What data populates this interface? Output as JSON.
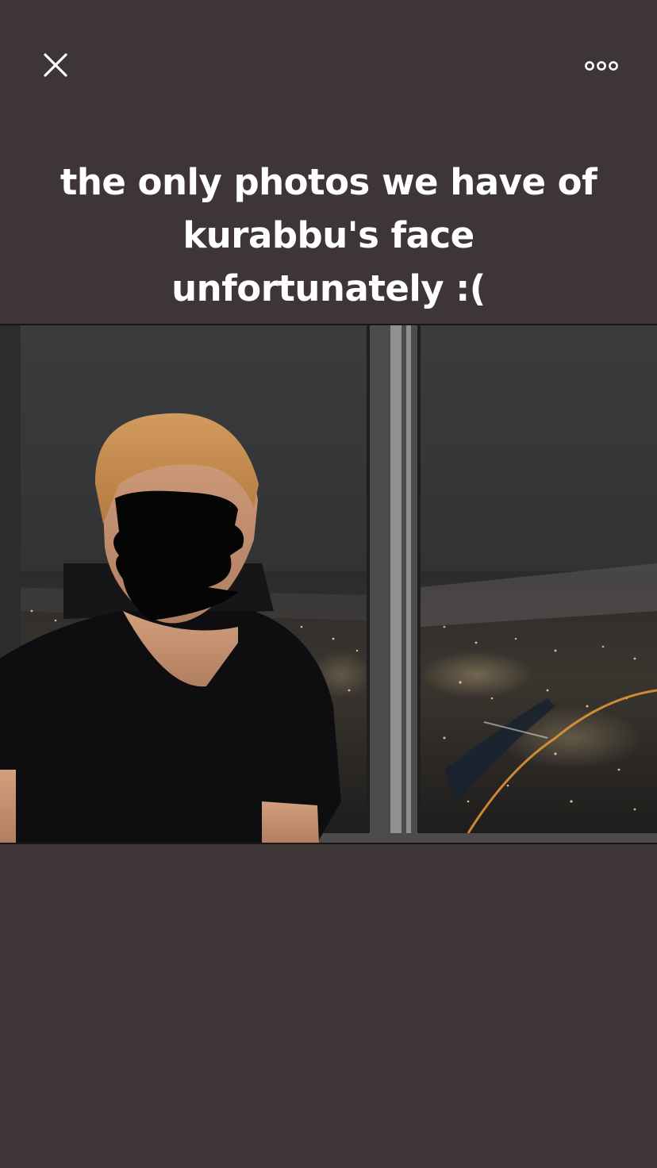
{
  "story": {
    "caption": "the only photos we have of kurabbu's face unfortunately :(",
    "close_icon": "close-icon",
    "more_icon": "more-options-icon",
    "photo_description_icon": "photo"
  },
  "colors": {
    "background": "#3e3537",
    "text": "#ffffff"
  }
}
